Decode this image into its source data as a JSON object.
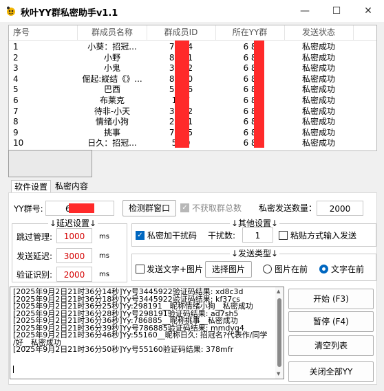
{
  "window": {
    "title": "秋叶YY群私密助手v1.1",
    "minimize": "—",
    "maximize": "☐",
    "close": "✕"
  },
  "table": {
    "headers": [
      "序号",
      "群成员名称",
      "群成员ID",
      "所在YY群",
      "发送状态"
    ],
    "rows": [
      [
        "1",
        "小葵：招冠...",
        "73   54",
        "6        8",
        "私密成功"
      ],
      [
        "2",
        "小野",
        "80   61",
        "6        8",
        "私密成功"
      ],
      [
        "3",
        "小鬼",
        "30   72",
        "6        8",
        "私密成功"
      ],
      [
        "4",
        "倔起:縱结《》...",
        "83   90",
        "6        8",
        "私密成功"
      ],
      [
        "5",
        "巴西",
        "54   56",
        "6        8",
        "私密成功"
      ],
      [
        "6",
        "布莱克",
        "1    37",
        "6        8",
        "私密成功"
      ],
      [
        "7",
        "待非-小天",
        "34   22",
        "6        8",
        "私密成功"
      ],
      [
        "8",
        "情绪小狗",
        "29   91",
        "6        8",
        "私密成功"
      ],
      [
        "9",
        "挑事",
        "78   85",
        "6        8",
        "私密成功"
      ],
      [
        "10",
        "日久：招冠...",
        "5    60",
        "6        8",
        "私密成功"
      ]
    ]
  },
  "tabs": {
    "settings": "软件设置",
    "private": "私密内容"
  },
  "settings": {
    "yy_group_label": "YY群号:",
    "yy_group_value": "6",
    "detect_button": "检测群窗口",
    "no_total_label": "不获取群总数",
    "send_count_label": "私密发送数量：",
    "send_count_value": "2000",
    "delay_group_title": "↓延迟设置↓",
    "skip_label": "跳过管理:",
    "skip_value": "1000",
    "skip_unit": "ms",
    "send_delay_label": "发送延迟:",
    "send_delay_value": "3000",
    "send_delay_unit": "ms",
    "verify_label": "验证识别:",
    "verify_value": "2000",
    "verify_unit": "ms",
    "other_group_title": "↓其他设置↓",
    "add_noise_label": "私密加干扰码",
    "noise_count_label": "干扰数:",
    "noise_count_value": "1",
    "paste_label": "粘贴方式输入发送",
    "send_type_title": "↓发送类型↓",
    "send_text_image_label": "发送文字+图片",
    "select_image_button": "选择图片",
    "image_first_label": "图片在前",
    "text_first_label": "文字在前"
  },
  "log": [
    "[2025年9月2日21时36分14秒]Yy号3445922验证码结果: xd8c3d",
    "[2025年9月2日21时36分18秒]Yy号3445922验证码结果: kf37cs",
    "[2025年9月2日21时36分25秒]Yy:298191__昵称情绪小狗__私密成功",
    "[2025年9月2日21时36分28秒]Yy号298191验证码结果: ad7sh5",
    "[2025年9月2日21时36分36秒]Yy:786885__昵称挑事__私密成功",
    "[2025年9月2日21时36分39秒]Yy号786885验证码结果: mmdvg4",
    "[2025年9月2日21时36分46秒]Yy:55160__昵称日久: 招冠名?代表作/同学",
    "/好__私密成功",
    "[2025年9月2日21时36分50秒]Yy号55160验证码结果: 378mfr"
  ],
  "actions": {
    "start": "开始 (F3)",
    "pause": "暂停 (F4)",
    "clear": "清空列表",
    "close_all": "关闭全部YY"
  },
  "colors": {
    "accent": "#0067c0",
    "redact": "#ff2a2a",
    "input_red_text": "#d40000"
  }
}
